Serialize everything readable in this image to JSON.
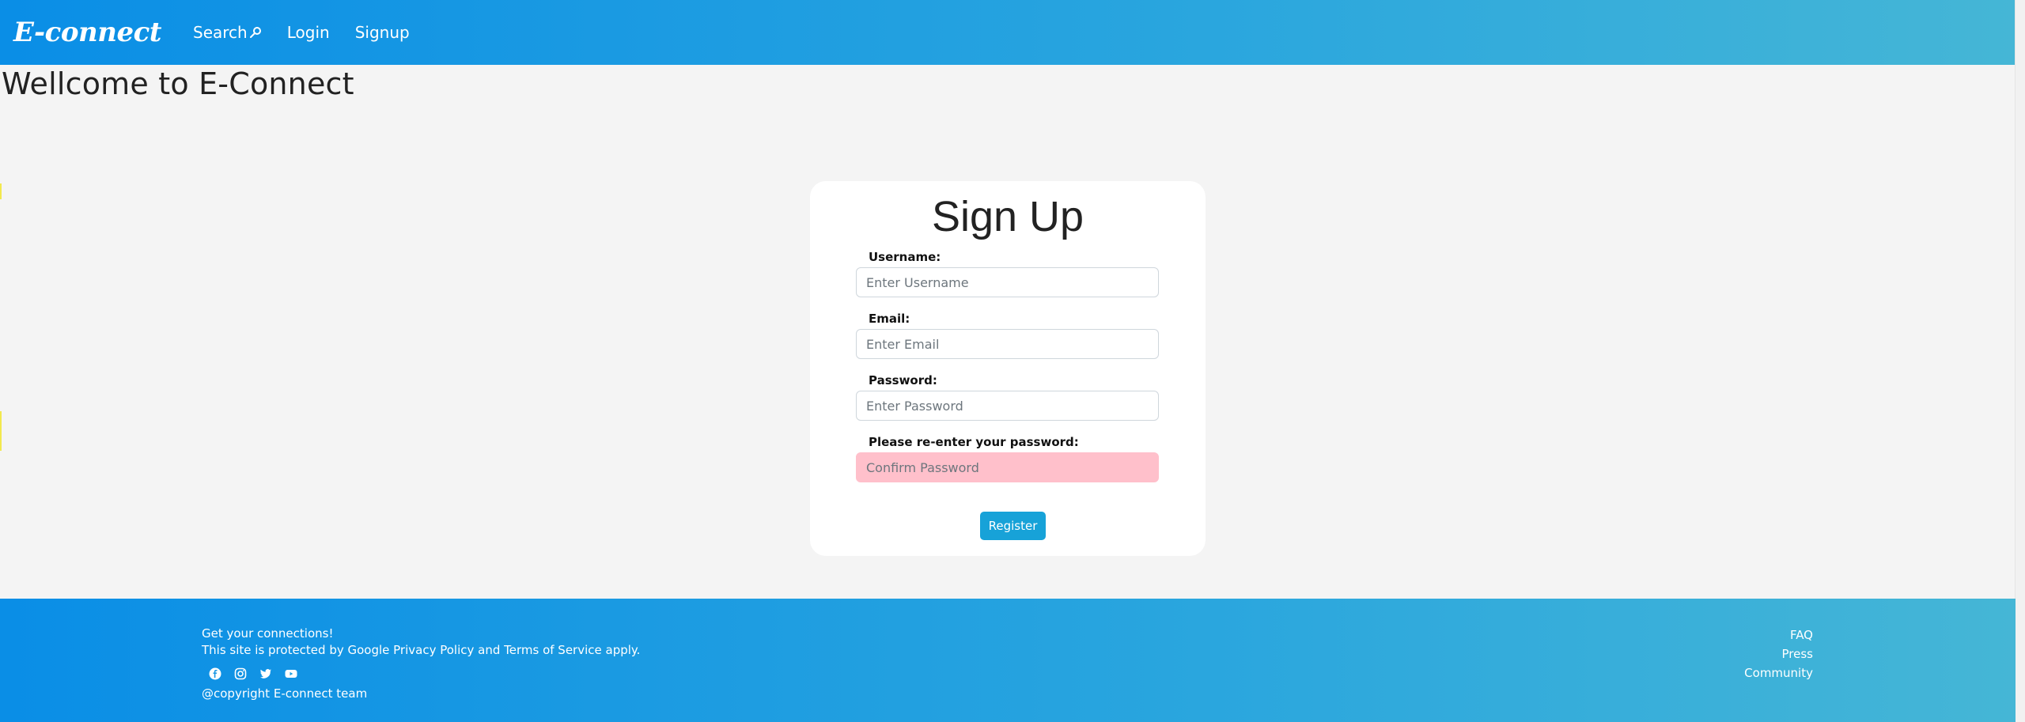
{
  "navbar": {
    "brand": "E-connect",
    "links": [
      {
        "label": "Search",
        "icon": "search-icon"
      },
      {
        "label": "Login"
      },
      {
        "label": "Signup"
      }
    ]
  },
  "page": {
    "title": "Wellcome to E-Connect"
  },
  "signup": {
    "title": "Sign Up",
    "fields": [
      {
        "label": "Username:",
        "placeholder": "Enter Username",
        "value": ""
      },
      {
        "label": "Email:",
        "placeholder": "Enter Email",
        "value": ""
      },
      {
        "label": "Password:",
        "placeholder": "Enter Password",
        "value": ""
      },
      {
        "label": "Please re-enter your password:",
        "placeholder": "Confirm Password",
        "value": "",
        "state": "error"
      }
    ],
    "submit_label": "Register"
  },
  "footer": {
    "tagline": "Get your connections!",
    "notice": "This site is protected by Google Privacy Policy and Terms of Service apply.",
    "socials": [
      "facebook-icon",
      "instagram-icon",
      "twitter-icon",
      "youtube-icon"
    ],
    "copyright": "@copyright E-connect team",
    "links": [
      "FAQ",
      "Press",
      "Community"
    ]
  },
  "colors": {
    "nav_gradient_start": "#0a8ee6",
    "nav_gradient_end": "#45b6d6",
    "register_button": "#17a2d8",
    "error_field": "#ffc0cb",
    "page_background": "#f4f4f4"
  }
}
